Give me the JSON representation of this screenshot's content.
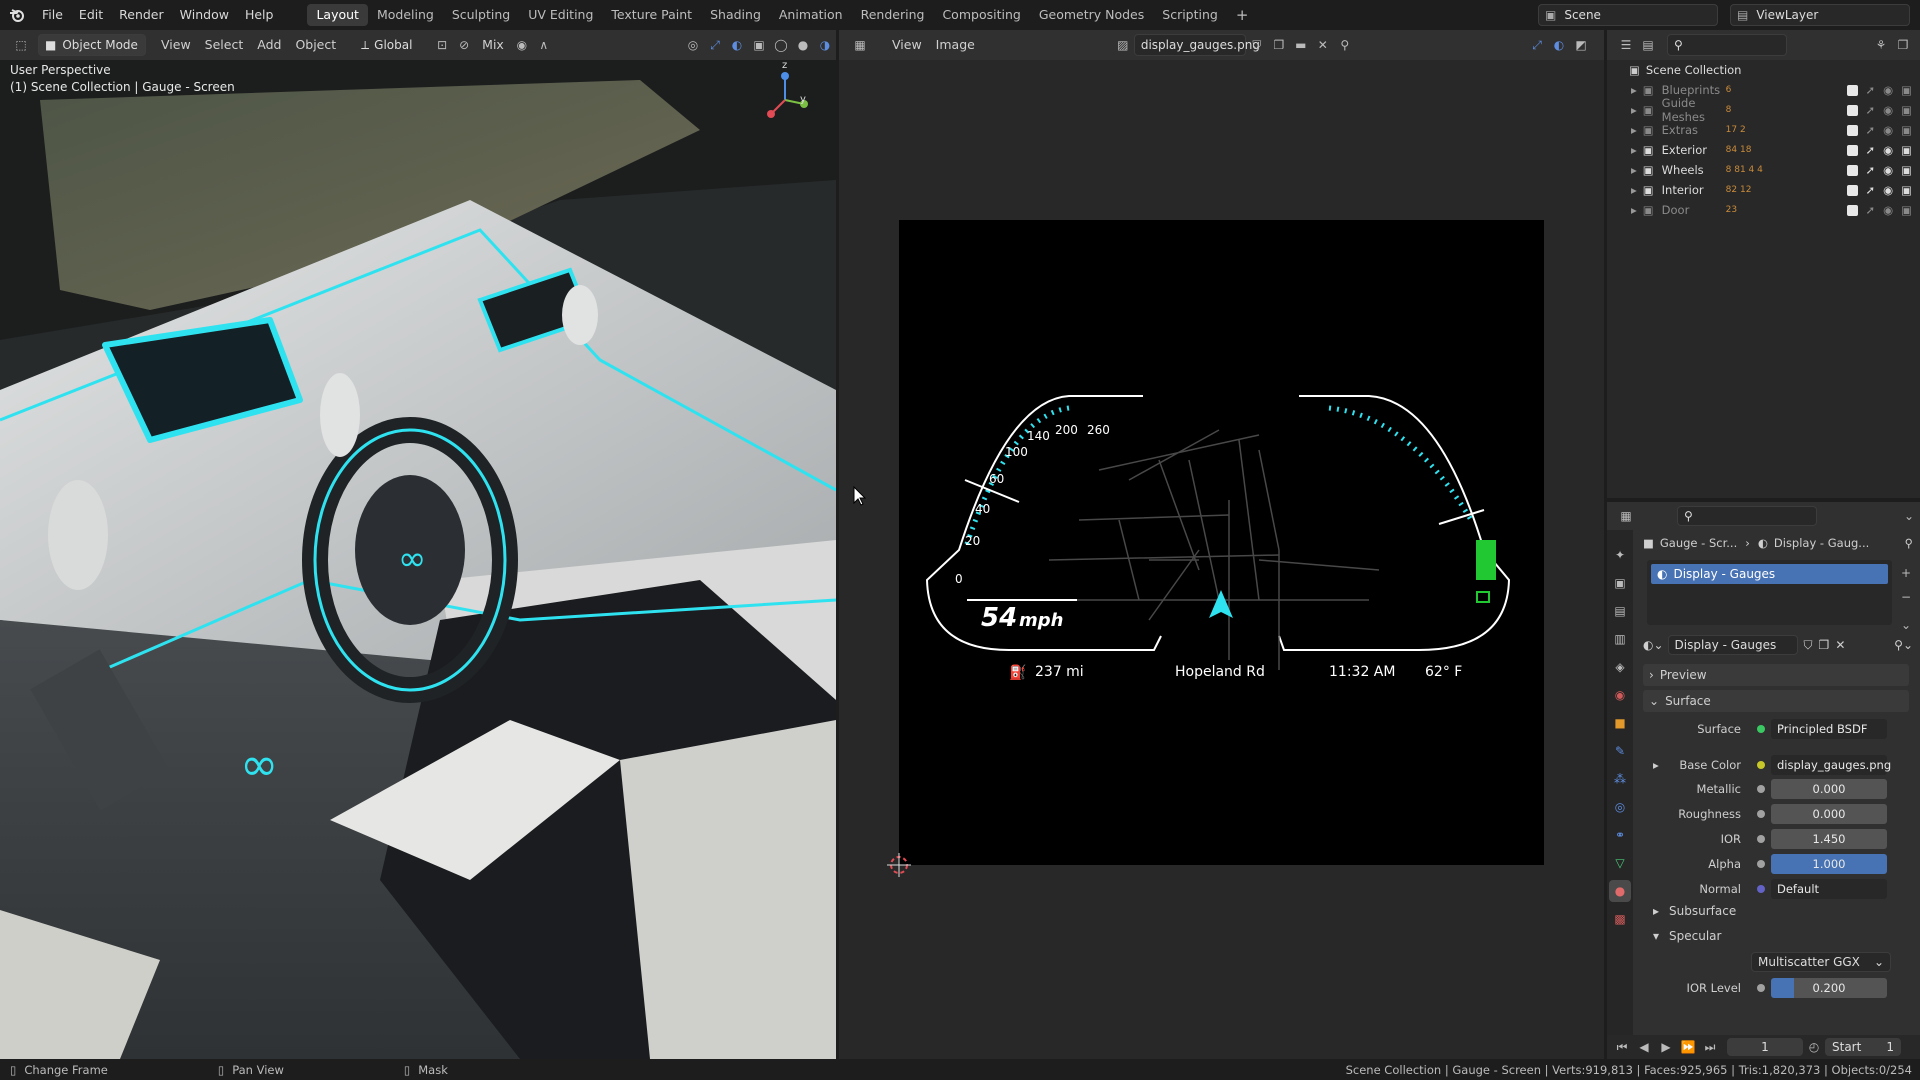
{
  "topbar": {
    "menus": [
      "File",
      "Edit",
      "Render",
      "Window",
      "Help"
    ],
    "workspaces": [
      "Layout",
      "Modeling",
      "Sculpting",
      "UV Editing",
      "Texture Paint",
      "Shading",
      "Animation",
      "Rendering",
      "Compositing",
      "Geometry Nodes",
      "Scripting"
    ],
    "active_workspace": "Layout",
    "add_tab": "+",
    "scene": "Scene",
    "view_layer": "ViewLayer"
  },
  "viewport": {
    "mode": "Object Mode",
    "menus": [
      "View",
      "Select",
      "Add",
      "Object"
    ],
    "transform": "Global",
    "snap_mix": "Mix",
    "overlay_title": "User Perspective",
    "overlay_subtitle": "(1) Scene Collection | Gauge - Screen",
    "axis_z": "z",
    "axis_y": "y"
  },
  "image_editor": {
    "menus": [
      "View",
      "Image"
    ],
    "image_name": "display_gauges.png",
    "gauge": {
      "speed_ticks": [
        "0",
        "20",
        "40",
        "60",
        "100",
        "140",
        "200",
        "260"
      ],
      "speed_value": "54",
      "speed_unit": "mph",
      "range": "237 mi",
      "street": "Hopeland Rd",
      "time": "11:32 AM",
      "temp": "62° F",
      "fuel_fraction": 0.25
    }
  },
  "outliner": {
    "root": "Scene Collection",
    "items": [
      {
        "name": "Blueprints",
        "count": "6",
        "dim": true
      },
      {
        "name": "Guide Meshes",
        "count": "8",
        "dim": true
      },
      {
        "name": "Extras",
        "count": "17 2",
        "dim": true
      },
      {
        "name": "Exterior",
        "count": "84 18",
        "dim": false
      },
      {
        "name": "Wheels",
        "count": "8 81 4 4",
        "dim": false
      },
      {
        "name": "Interior",
        "count": "82 12",
        "dim": false
      },
      {
        "name": "Door",
        "count": "23",
        "dim": true
      }
    ]
  },
  "properties": {
    "breadcrumb_obj": "Gauge - Scr...",
    "breadcrumb_mat": "Display - Gaug...",
    "slot": "Display - Gauges",
    "material": "Display - Gauges",
    "sections": {
      "preview": "Preview",
      "surface": "Surface",
      "subsurface": "Subsurface",
      "specular": "Specular"
    },
    "rows": {
      "surface_label": "Surface",
      "surface_val": "Principled BSDF",
      "basecolor_label": "Base Color",
      "basecolor_val": "display_gauges.png",
      "metallic_label": "Metallic",
      "metallic_val": "0.000",
      "roughness_label": "Roughness",
      "roughness_val": "0.000",
      "ior_label": "IOR",
      "ior_val": "1.450",
      "alpha_label": "Alpha",
      "alpha_val": "1.000",
      "normal_label": "Normal",
      "normal_val": "Default",
      "distribution": "Multiscatter GGX",
      "iorlevel_label": "IOR Level",
      "iorlevel_val": "0.200"
    }
  },
  "timeline": {
    "frame": "1",
    "start_label": "Start",
    "start_val": "1"
  },
  "statusbar": {
    "hint1": "Change Frame",
    "hint2": "Pan View",
    "hint3": "Mask",
    "stats": "Scene Collection | Gauge - Screen | Verts:919,813 | Faces:925,965 | Tris:1,820,373 | Objects:0/254"
  },
  "colors": {
    "accent": "#4772b3",
    "cyan": "#2fe2f0",
    "green": "#22c832"
  }
}
